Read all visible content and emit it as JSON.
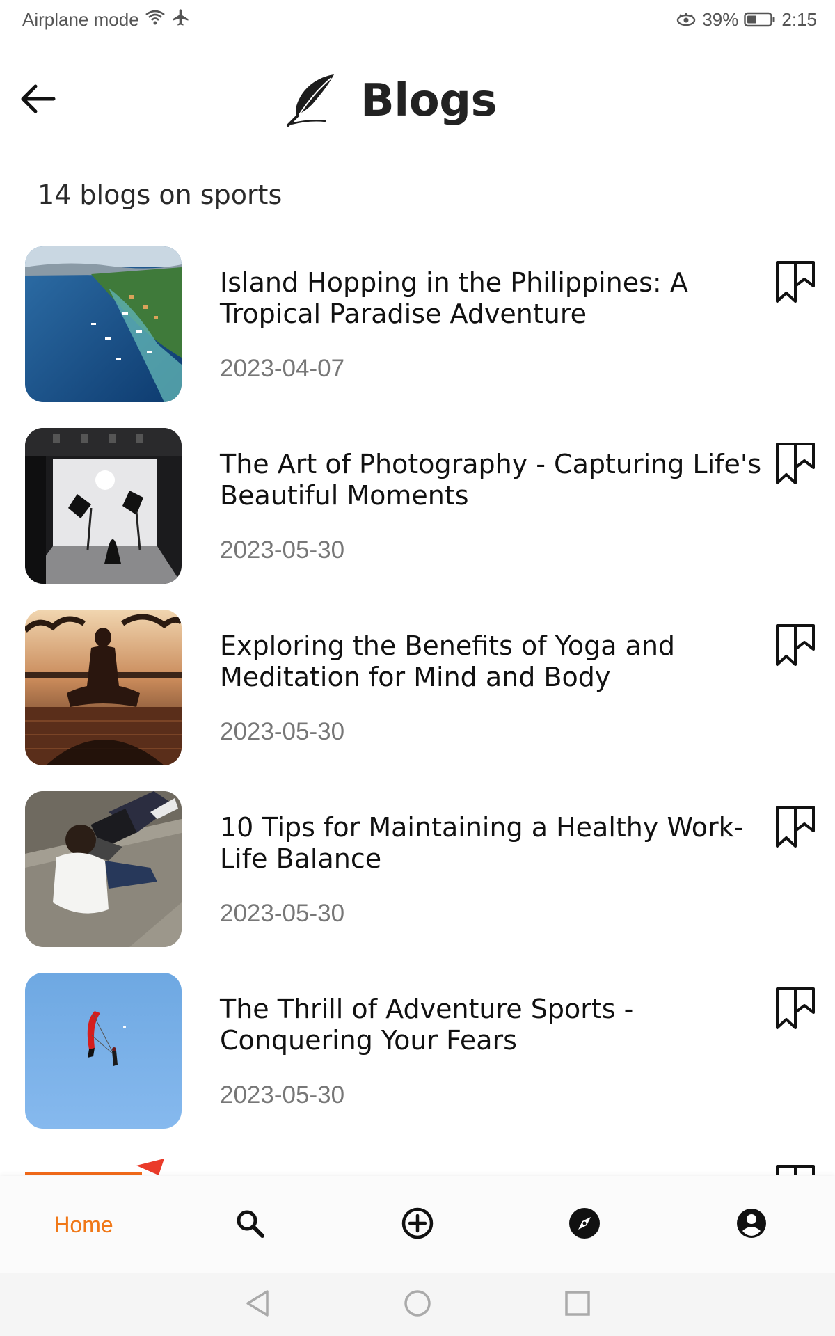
{
  "status_bar": {
    "left_text": "Airplane mode",
    "battery_percent": "39%",
    "time": "2:15"
  },
  "header": {
    "title": "Blogs",
    "logo_icon": "feather-quill-icon",
    "back_icon": "arrow-left-icon"
  },
  "summary": {
    "count_text": "14 blogs on sports"
  },
  "blogs": [
    {
      "title": "Island Hopping in the Philippines: A Tropical Paradise Adventure",
      "date": "2023-04-07",
      "thumbnail": "coastal-islands-aerial-photo"
    },
    {
      "title": "The Art of Photography - Capturing Life's Beautiful Moments",
      "date": "2023-05-30",
      "thumbnail": "photo-studio-photo"
    },
    {
      "title": "Exploring the Benefits of Yoga and Meditation for Mind and Body",
      "date": "2023-05-30",
      "thumbnail": "meditation-sunset-photo"
    },
    {
      "title": "10 Tips for Maintaining a Healthy Work-Life Balance",
      "date": "2023-05-30",
      "thumbnail": "laptop-on-steps-photo"
    },
    {
      "title": "The Thrill of Adventure Sports - Conquering Your Fears",
      "date": "2023-05-30",
      "thumbnail": "paraglider-sky-photo"
    }
  ],
  "bottom_nav": {
    "home_label": "Home",
    "icons": [
      "search-icon",
      "add-circle-icon",
      "compass-icon",
      "profile-icon"
    ]
  },
  "colors": {
    "accent": "#f07818",
    "title_text": "#111111",
    "date_text": "#777777"
  }
}
